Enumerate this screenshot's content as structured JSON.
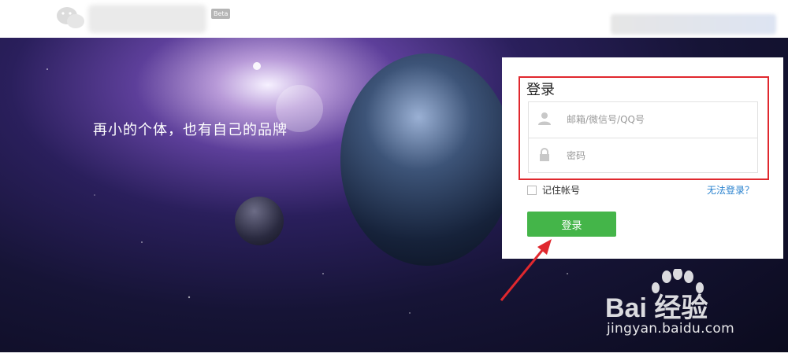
{
  "header": {
    "beta_label": "Beta"
  },
  "hero": {
    "slogan": "再小的个体，也有自己的品牌"
  },
  "login": {
    "title": "登录",
    "account_placeholder": "邮箱/微信号/QQ号",
    "password_placeholder": "密码",
    "remember_label": "记住帐号",
    "cant_login_label": "无法登录？",
    "submit_label": "登录"
  },
  "watermark": {
    "brand_text": "Bai 经验",
    "url": "jingyan.baidu.com"
  },
  "colors": {
    "primary_button": "#44b549",
    "link": "#2b83cf",
    "highlight_box": "#e0282e"
  }
}
